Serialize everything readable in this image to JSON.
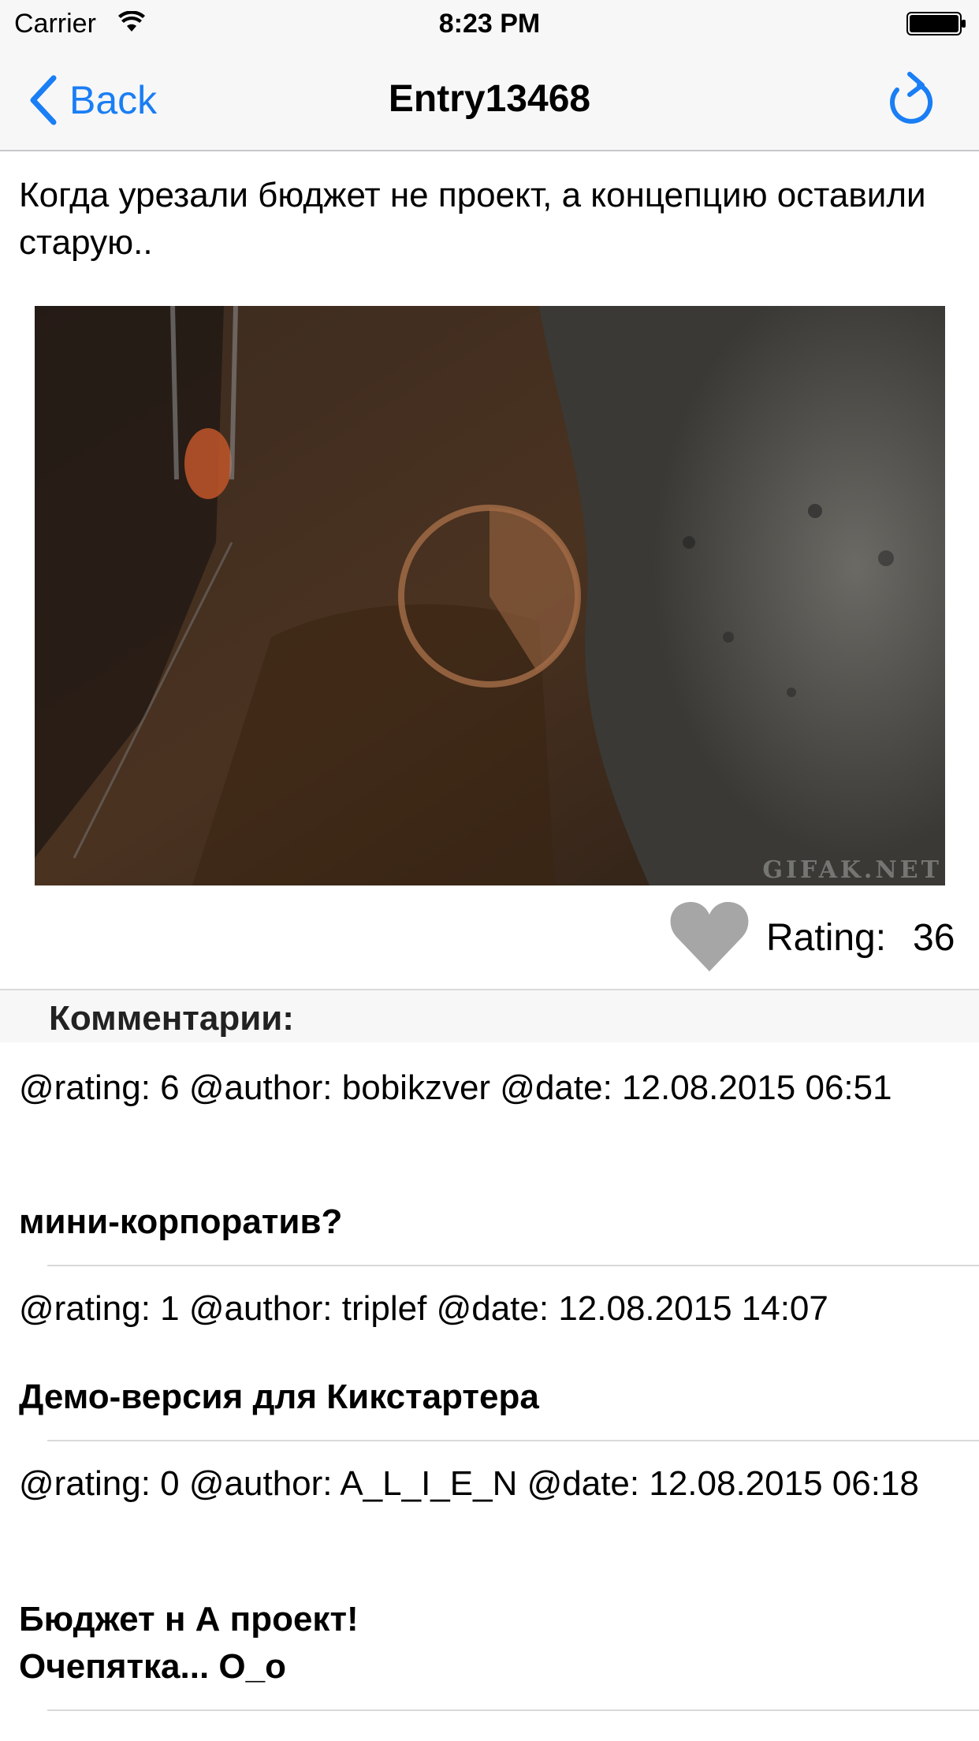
{
  "status_bar": {
    "carrier": "Carrier",
    "time": "8:23 PM",
    "wifi_icon": "wifi-icon",
    "battery_icon": "battery-icon"
  },
  "nav": {
    "back_label": "Back",
    "title": "Entry13468",
    "refresh_icon": "refresh-icon",
    "accent_color": "#1a7ef5"
  },
  "entry": {
    "text": "Когда урезали бюджет не проект, а концепцию оставили старую..",
    "media_watermark": "GIFAK.NET",
    "heart_icon": "heart-icon",
    "rating_label": "Rating:",
    "rating_value": "36"
  },
  "comments_section": {
    "title": "Комментарии:",
    "items": [
      {
        "meta": "@rating: 6 @author: bobikzver @date: 12.08.2015 06:51",
        "body": "мини-корпоратив?"
      },
      {
        "meta": "@rating: 1 @author: triplef @date: 12.08.2015 14:07",
        "body": "Демо-версия для Кикстартера"
      },
      {
        "meta": "@rating: 0 @author: A_L_I_E_N @date: 12.08.2015 06:18",
        "body": "Бюджет н А проект!\nОчепятка... О_о"
      }
    ]
  }
}
